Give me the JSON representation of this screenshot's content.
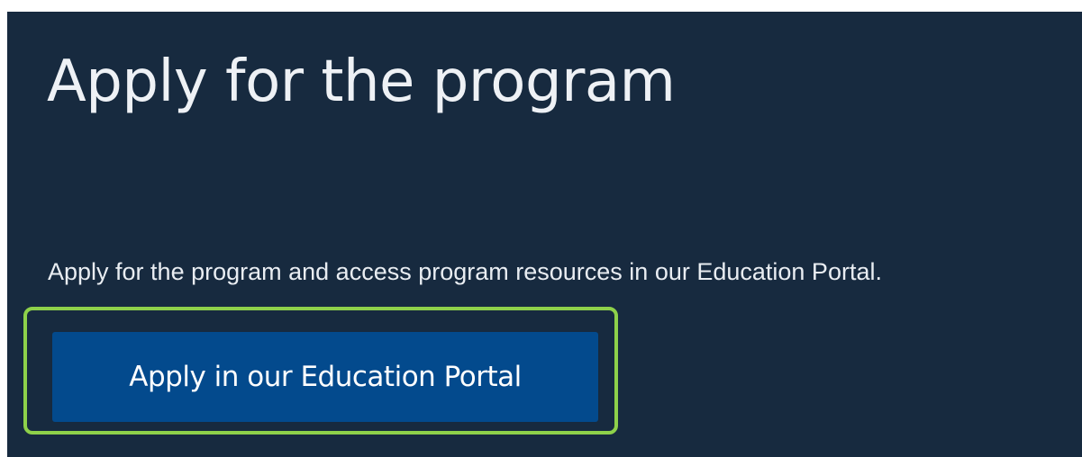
{
  "section": {
    "title": "Apply for the program",
    "description": "Apply for the program and access program resources in our Education Portal.",
    "cta_label": "Apply in our Education Portal"
  },
  "colors": {
    "panel_background": "#172a3f",
    "button_background": "#034a8d",
    "highlight_border": "#8ed14a",
    "text": "#eef1f5"
  }
}
